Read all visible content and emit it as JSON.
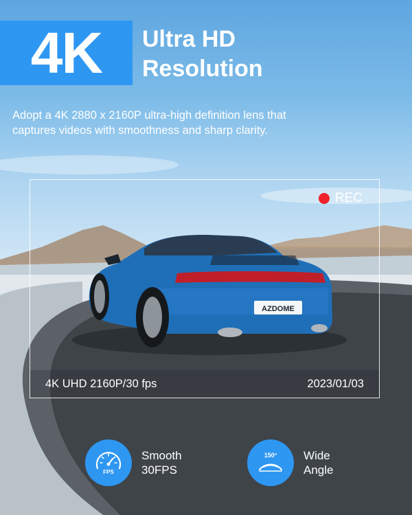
{
  "badge": {
    "text": "4K"
  },
  "headline": {
    "line1": "Ultra HD",
    "line2": "Resolution"
  },
  "description": {
    "line1": "Adopt a 4K 2880 x 2160P ultra-high definition lens that",
    "line2": "captures videos with smoothness and sharp clarity."
  },
  "recording": {
    "label": "REC",
    "resolution_text": "4K UHD 2160P/30 fps",
    "date": "2023/01/03"
  },
  "car": {
    "plate": "AZDOME"
  },
  "features": [
    {
      "icon": "speedometer-icon",
      "icon_label": "FPS",
      "line1": "Smooth",
      "line2": "30FPS"
    },
    {
      "icon": "wide-angle-icon",
      "icon_label": "150°",
      "line1": "Wide",
      "line2": "Angle"
    }
  ],
  "colors": {
    "accent": "#2e97f2",
    "rec": "#f2222a",
    "car": "#1f6fb8"
  }
}
